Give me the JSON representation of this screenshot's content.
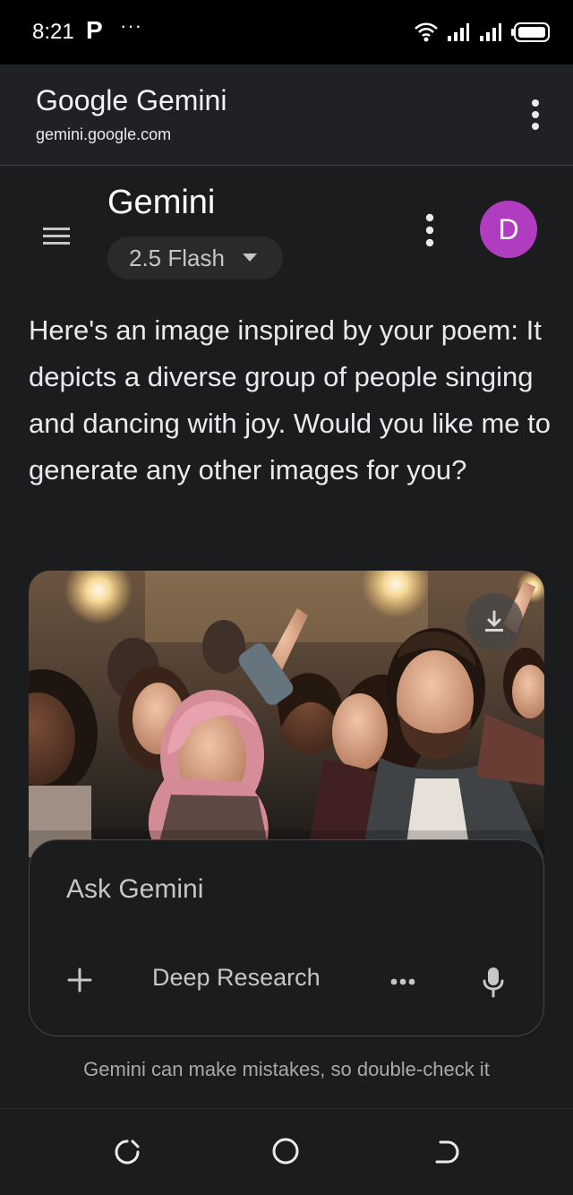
{
  "status_bar": {
    "time": "8:21",
    "notification_icon": "P",
    "more_notifications": "···",
    "icons": [
      "wifi-icon",
      "signal-icon",
      "signal-icon",
      "battery-icon"
    ]
  },
  "browser": {
    "site_title": "Google Gemini",
    "site_url": "gemini.google.com"
  },
  "app": {
    "title": "Gemini",
    "model": "2.5 Flash",
    "avatar_letter": "D",
    "avatar_color": "#b03cc0"
  },
  "message": {
    "text": "Here's an image inspired by your poem: It depicts a diverse group of people singing and dancing with joy. Would you like me to generate any other images for you?"
  },
  "composer": {
    "placeholder": "Ask Gemini",
    "deep_research_label": "Deep Research",
    "more_tools": "•••"
  },
  "disclaimer": "Gemini can make mistakes, so double-check it",
  "navigation": {
    "icons": [
      "recents-icon",
      "home-icon",
      "back-icon"
    ]
  },
  "colors": {
    "background": "#1b1c1d",
    "surface": "#282a2c",
    "accent": "#b03cc0"
  }
}
